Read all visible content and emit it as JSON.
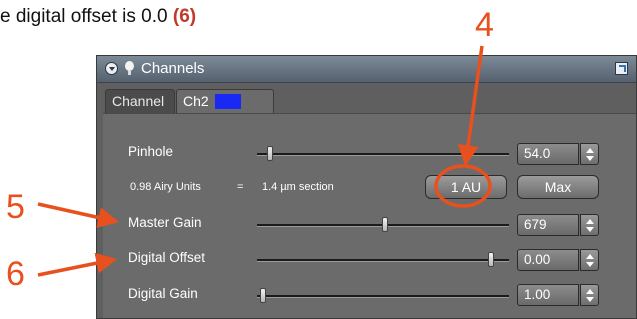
{
  "caption": {
    "text": "e digital offset is 0.0 ",
    "highlight": "(6)"
  },
  "annotations": {
    "label_4": "4",
    "label_5": "5",
    "label_6": "6",
    "color": "#e8501e"
  },
  "panel": {
    "title": "Channels",
    "tabs": [
      {
        "label": "Channel",
        "active": false
      },
      {
        "label": "Ch2",
        "active": true,
        "swatch_color": "#1a28f5"
      }
    ],
    "pinhole": {
      "label": "Pinhole",
      "value": "54.0",
      "airy_text": "0.98 Airy Units",
      "equals": "=",
      "section_text": "1.4 µm section",
      "button_1au": "1 AU",
      "button_max": "Max"
    },
    "master_gain": {
      "label": "Master Gain",
      "value": "679"
    },
    "digital_offset": {
      "label": "Digital Offset",
      "value": "0.00"
    },
    "digital_gain": {
      "label": "Digital Gain",
      "value": "1.00"
    }
  },
  "colors": {
    "panel_bg": "#6b6b6b",
    "titlebar": "#6f7c8a",
    "annotation": "#e8501e"
  }
}
